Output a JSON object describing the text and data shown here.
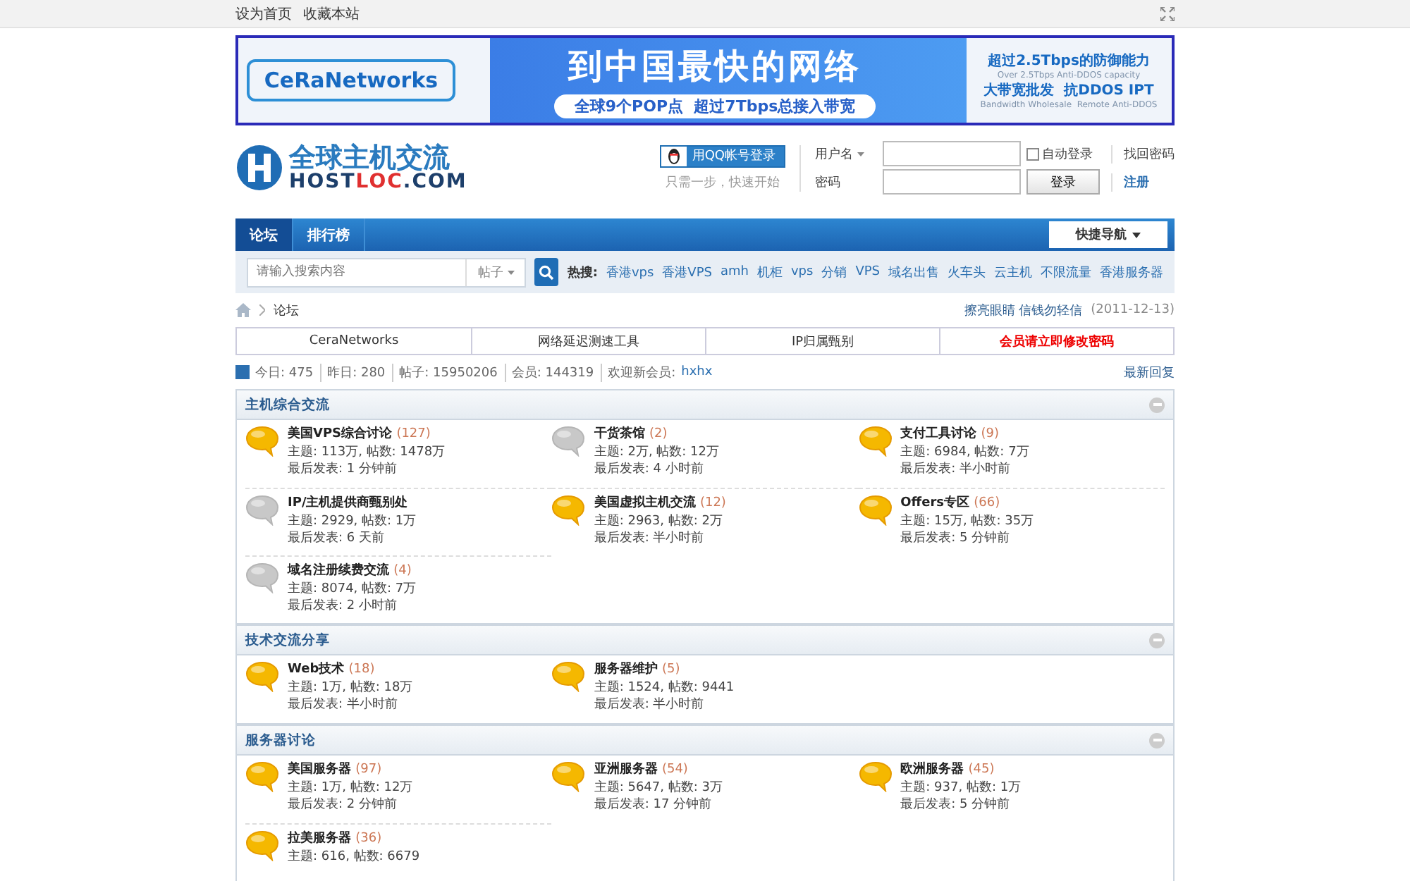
{
  "topbar": {
    "links": [
      "设为首页",
      "收藏本站"
    ]
  },
  "banner": {
    "brand": "CeRaNetworks",
    "headline": "到中国最快的网络",
    "subline": "全球9个POP点  超过7Tbps总接入带宽",
    "right_title": "超过2.5Tbps的防御能力",
    "right_caption": "Over 2.5Tbps Anti-DDOS capacity",
    "right_subtitle": "大带宽批发  抗DDOS IPT",
    "right_footer": "Bandwidth Wholesale  Remote Anti-DDOS"
  },
  "logo": {
    "cn": "全球主机交流",
    "host": "HOST",
    "loc": "LOC",
    "com": ".COM"
  },
  "qq_login": {
    "button": "用QQ帐号登录",
    "hint": "只需一步，快速开始"
  },
  "login": {
    "username_label": "用户名",
    "password_label": "密码",
    "auto_login": {
      "label": "自动登录",
      "checked": false
    },
    "submit": "登录",
    "forgot": "找回密码",
    "register": "注册"
  },
  "nav": {
    "tabs": [
      {
        "label": "论坛",
        "selected": true
      },
      {
        "label": "排行榜",
        "selected": false
      }
    ],
    "quick_nav": "快捷导航"
  },
  "search": {
    "placeholder": "请输入搜索内容",
    "scope": "帖子",
    "hot_label": "热搜:",
    "hot": [
      "香港vps",
      "香港VPS",
      "amh",
      "机柜",
      "vps",
      "分销",
      "VPS",
      "域名出售",
      "火车头",
      "云主机",
      "不限流量",
      "香港服务器"
    ]
  },
  "breadcrumb": {
    "current": "论坛",
    "notice": "擦亮眼睛 信钱勿轻信",
    "date": "(2011-12-13)"
  },
  "links": [
    {
      "label": "CeraNetworks",
      "alert": false
    },
    {
      "label": "网络延迟测速工具",
      "alert": false
    },
    {
      "label": "IP归属甄别",
      "alert": false
    },
    {
      "label": "会员请立即修改密码",
      "alert": true
    }
  ],
  "stats": {
    "items": [
      "今日: 475",
      "昨日: 280",
      "帖子: 15950206",
      "会员: 144319"
    ],
    "welcome": "欢迎新会员:",
    "new_member": "hxhx",
    "latest": "最新回复"
  },
  "sections": [
    {
      "title": "主机综合交流",
      "forums": [
        {
          "name": "美国VPS综合讨论",
          "today": "(127)",
          "counts": "主题: 113万, 帖数: 1478万",
          "last": "最后发表: 1 分钟前",
          "new": true
        },
        {
          "name": "干货茶馆",
          "today": "(2)",
          "counts": "主题: 2万, 帖数: 12万",
          "last": "最后发表: 4 小时前",
          "new": false
        },
        {
          "name": "支付工具讨论",
          "today": "(9)",
          "counts": "主题: 6984, 帖数: 7万",
          "last": "最后发表: 半小时前",
          "new": true
        },
        {
          "name": "IP/主机提供商甄别处",
          "counts": "主题: 2929, 帖数: 1万",
          "last": "最后发表: 6 天前",
          "new": false
        },
        {
          "name": "美国虚拟主机交流",
          "today": "(12)",
          "counts": "主题: 2963, 帖数: 2万",
          "last": "最后发表: 半小时前",
          "new": true
        },
        {
          "name": "Offers专区",
          "today": "(66)",
          "counts": "主题: 15万, 帖数: 35万",
          "last": "最后发表: 5 分钟前",
          "new": true
        },
        {
          "name": "域名注册续费交流",
          "today": "(4)",
          "counts": "主题: 8074, 帖数: 7万",
          "last": "最后发表: 2 小时前",
          "new": false
        }
      ]
    },
    {
      "title": "技术交流分享",
      "forums": [
        {
          "name": "Web技术",
          "today": "(18)",
          "counts": "主题: 1万, 帖数: 18万",
          "last": "最后发表: 半小时前",
          "new": true
        },
        {
          "name": "服务器维护",
          "today": "(5)",
          "counts": "主题: 1524, 帖数: 9441",
          "last": "最后发表: 半小时前",
          "new": true
        }
      ]
    },
    {
      "title": "服务器讨论",
      "forums": [
        {
          "name": "美国服务器",
          "today": "(97)",
          "counts": "主题: 1万, 帖数: 12万",
          "last": "最后发表: 2 分钟前",
          "new": true
        },
        {
          "name": "亚洲服务器",
          "today": "(54)",
          "counts": "主题: 5647, 帖数: 3万",
          "last": "最后发表: 17 分钟前",
          "new": true
        },
        {
          "name": "欧洲服务器",
          "today": "(45)",
          "counts": "主题: 937, 帖数: 1万",
          "last": "最后发表: 5 分钟前",
          "new": true
        },
        {
          "name": "拉美服务器",
          "today": "(36)",
          "counts": "主题: 616, 帖数: 6679",
          "new": true
        }
      ]
    }
  ]
}
